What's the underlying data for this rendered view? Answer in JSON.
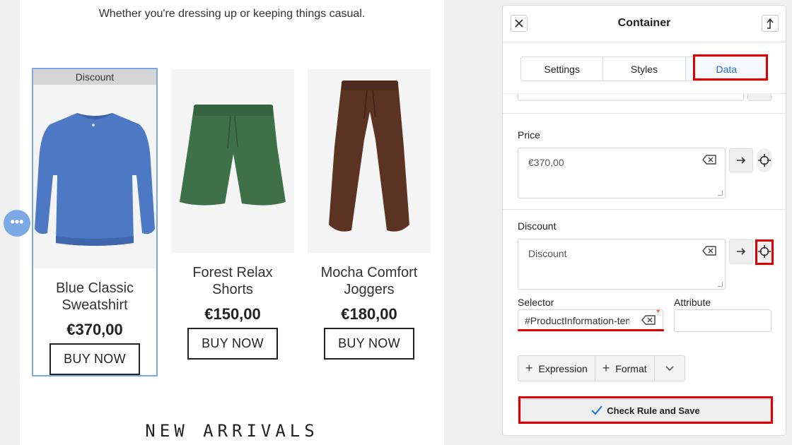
{
  "preview": {
    "tagline": "Whether you're dressing up or keeping things casual.",
    "products": [
      {
        "badge": "Discount",
        "name": "Blue Classic Sweatshirt",
        "price": "€370,00",
        "buy_label": "BUY NOW",
        "image": "blue-sweatshirt"
      },
      {
        "name": "Forest Relax Shorts",
        "price": "€150,00",
        "buy_label": "BUY NOW",
        "image": "green-shorts"
      },
      {
        "name": "Mocha Comfort Joggers",
        "price": "€180,00",
        "buy_label": "BUY NOW",
        "image": "brown-joggers"
      }
    ],
    "section_heading": "NEW ARRIVALS",
    "more_button_icon": "ellipsis-icon"
  },
  "panel": {
    "title": "Container",
    "tabs": [
      {
        "label": "Settings",
        "active": false
      },
      {
        "label": "Styles",
        "active": false
      },
      {
        "label": "Data",
        "active": true
      }
    ],
    "price": {
      "label": "Price",
      "value": "€370,00"
    },
    "discount": {
      "label": "Discount",
      "value": "Discount"
    },
    "selector": {
      "label": "Selector",
      "value": "#ProductInformation-template",
      "required": true
    },
    "attribute": {
      "label": "Attribute",
      "value": ""
    },
    "buttons": {
      "expression": "Expression",
      "format": "Format"
    },
    "save_label": "Check Rule and Save",
    "colors": {
      "accent": "#1f6fd1",
      "highlight": "#e00000",
      "selection": "#7aa9e6"
    }
  }
}
